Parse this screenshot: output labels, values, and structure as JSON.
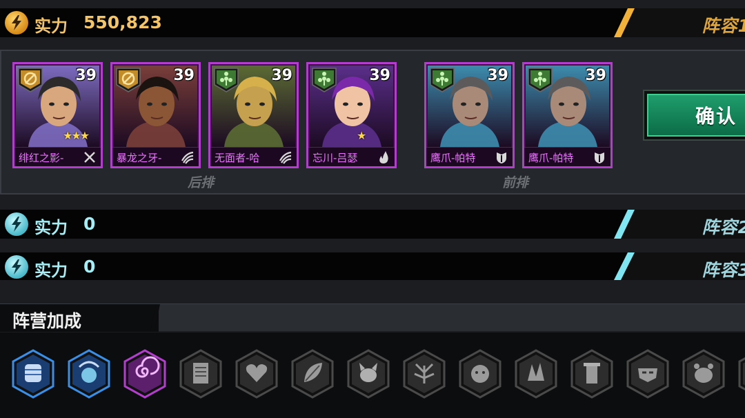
{
  "teams": [
    {
      "power_label": "实力",
      "power_value": "550,823",
      "tab_label": "阵容1",
      "accent": "#f2b23a"
    },
    {
      "power_label": "实力",
      "power_value": "0",
      "tab_label": "阵容2",
      "accent": "#7fe6f2"
    },
    {
      "power_label": "实力",
      "power_value": "0",
      "tab_label": "阵容3",
      "accent": "#7fe6f2"
    }
  ],
  "lineup": {
    "back_row_label": "后排",
    "front_row_label": "前排",
    "confirm_label": "确认",
    "heroes": [
      {
        "name": "绯红之影-",
        "level": "39",
        "stars": "★★★",
        "faction": "orange-faction-icon",
        "class": "swords-icon",
        "skin": "#d9a77e",
        "hair": "#2c2a2a",
        "accent": "#7d6cc0"
      },
      {
        "name": "暴龙之牙-",
        "level": "39",
        "stars": "",
        "faction": "orange-faction-icon",
        "class": "claw-icon",
        "skin": "#8a5636",
        "hair": "#1a1310",
        "accent": "#7a3f3a"
      },
      {
        "name": "无面者-哈",
        "level": "39",
        "stars": "",
        "faction": "green-faction-icon",
        "class": "claw-icon",
        "skin": "#c4a04f",
        "hair": "#d6b04a",
        "accent": "#5b6b34"
      },
      {
        "name": "忘川-吕瑟",
        "level": "39",
        "stars": "★",
        "faction": "green-faction-icon",
        "class": "flame-icon",
        "skin": "#f0c3a4",
        "hair": "#7a2aa8",
        "accent": "#5a2f8a"
      },
      {
        "name": "鹰爪-帕特",
        "level": "39",
        "stars": "",
        "faction": "green-faction-icon",
        "class": "shield-icon",
        "skin": "#a98a78",
        "hair": "#5c5a5a",
        "accent": "#3d8cae"
      },
      {
        "name": "鹰爪-帕特",
        "level": "39",
        "stars": "",
        "faction": "green-faction-icon",
        "class": "shield-icon",
        "skin": "#a98a78",
        "hair": "#5c5a5a",
        "accent": "#3d8cae"
      }
    ]
  },
  "bonus": {
    "title": "阵营加成",
    "icons": [
      {
        "name": "fist-icon",
        "active": true,
        "color": "#3b8ee6"
      },
      {
        "name": "orb-icon",
        "active": true,
        "color": "#3b8ee6"
      },
      {
        "name": "spiral-icon",
        "active": true,
        "color": "#b23fcc"
      },
      {
        "name": "tablet-icon",
        "active": false,
        "color": "#8a8a8a"
      },
      {
        "name": "heart-icon",
        "active": false,
        "color": "#8a8a8a"
      },
      {
        "name": "leaf-icon",
        "active": false,
        "color": "#8a8a8a"
      },
      {
        "name": "dog-icon",
        "active": false,
        "color": "#8a8a8a"
      },
      {
        "name": "plant-icon",
        "active": false,
        "color": "#8a8a8a"
      },
      {
        "name": "face-icon",
        "active": false,
        "color": "#8a8a8a"
      },
      {
        "name": "shard-icon",
        "active": false,
        "color": "#8a8a8a"
      },
      {
        "name": "tower-icon",
        "active": false,
        "color": "#8a8a8a"
      },
      {
        "name": "mask-icon",
        "active": false,
        "color": "#8a8a8a"
      },
      {
        "name": "beast-icon",
        "active": false,
        "color": "#8a8a8a"
      },
      {
        "name": "partial-icon",
        "active": false,
        "color": "#8a8a8a"
      }
    ]
  }
}
